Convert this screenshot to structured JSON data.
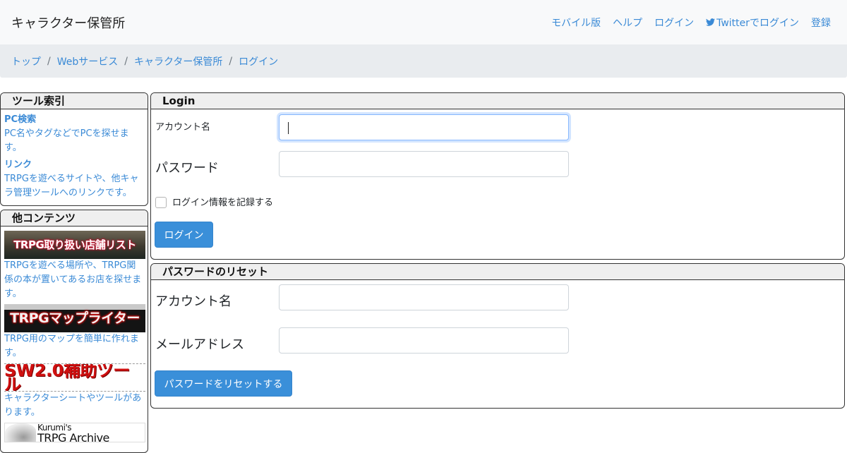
{
  "navbar": {
    "brand": "キャラクター保管所",
    "links": [
      "モバイル版",
      "ヘルプ",
      "ログイン",
      "Twitterでログイン",
      "登録"
    ]
  },
  "breadcrumb": [
    "トップ",
    "Webサービス",
    "キャラクター保管所",
    "ログイン"
  ],
  "sidebar": {
    "tool_index": {
      "title": "ツール索引",
      "items": [
        {
          "title": "PC検索",
          "desc": "PC名やタグなどでPCを探せます。"
        },
        {
          "title": "リンク",
          "desc": "TRPGを遊べるサイトや、他キャラ管理ツールへのリンクです。"
        }
      ]
    },
    "other": {
      "title": "他コンテンツ",
      "items": [
        {
          "banner": "TRPG取り扱い店舗リスト",
          "desc": "TRPGを遊べる場所や、TRPG関係の本が置いてあるお店を探せます。"
        },
        {
          "banner": "TRPGマップライター",
          "desc": "TRPG用のマップを簡単に作れます。"
        },
        {
          "banner": "SW2.0補助ツール",
          "desc": "キャラクターシートやツールがあります。"
        },
        {
          "banner_small": "Kurumi's",
          "banner_big": "TRPG Archive"
        }
      ]
    }
  },
  "login": {
    "title": "Login",
    "account_label": "アカウント名",
    "password_label": "パスワード",
    "remember_label": "ログイン情報を記録する",
    "submit": "ログイン"
  },
  "reset": {
    "title": "パスワードのリセット",
    "account_label": "アカウント名",
    "email_label": "メールアドレス",
    "submit": "パスワードをリセットする"
  }
}
